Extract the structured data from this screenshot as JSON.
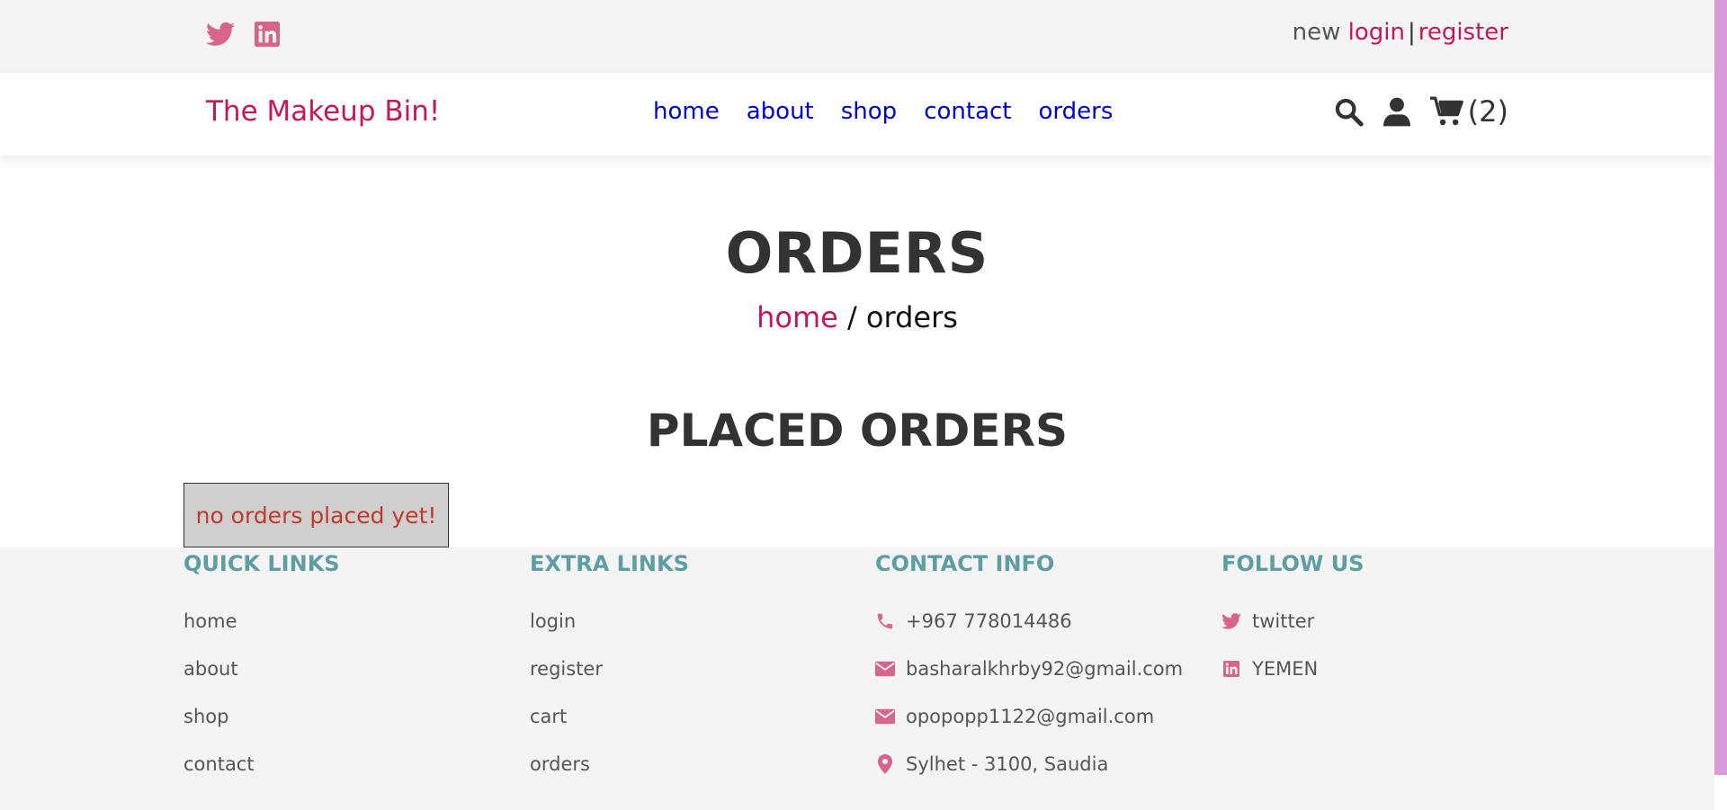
{
  "topbar": {
    "social_icons": [
      "twitter-icon",
      "linkedin-icon"
    ],
    "auth_prefix": "new",
    "login_label": "login",
    "separator": "|",
    "register_label": "register"
  },
  "header": {
    "logo": "The Makeup Bin!",
    "nav": [
      "home",
      "about",
      "shop",
      "contact",
      "orders"
    ],
    "icons": [
      "search-icon",
      "user-icon",
      "cart-icon"
    ],
    "cart_count": "(2)"
  },
  "page": {
    "title": "ORDERS",
    "breadcrumb_home": "home",
    "breadcrumb_sep": " / ",
    "breadcrumb_current": "orders",
    "section_title": "PLACED ORDERS",
    "empty_message": "no orders placed yet!"
  },
  "footer": {
    "quick_links": {
      "title": "QUICK LINKS",
      "items": [
        "home",
        "about",
        "shop",
        "contact"
      ]
    },
    "extra_links": {
      "title": "EXTRA LINKS",
      "items": [
        "login",
        "register",
        "cart",
        "orders"
      ]
    },
    "contact_info": {
      "title": "CONTACT INFO",
      "items": [
        {
          "icon": "phone-icon",
          "text": "+967 778014486"
        },
        {
          "icon": "envelope-icon",
          "text": "basharalkhrby92@gmail.com"
        },
        {
          "icon": "envelope-icon",
          "text": "opopopp1122@gmail.com"
        },
        {
          "icon": "map-marker-icon",
          "text": "Sylhet - 3100, Saudia"
        }
      ]
    },
    "follow_us": {
      "title": "FOLLOW US",
      "items": [
        {
          "icon": "twitter-icon",
          "text": "twitter"
        },
        {
          "icon": "linkedin-icon",
          "text": "YEMEN"
        }
      ]
    }
  },
  "colors": {
    "accent": "#c2185b",
    "icon_pink": "#d6648c",
    "footer_heading": "#5f9ea0",
    "nav_link": "#0000cc",
    "scrollbar": "#d89ad9"
  }
}
